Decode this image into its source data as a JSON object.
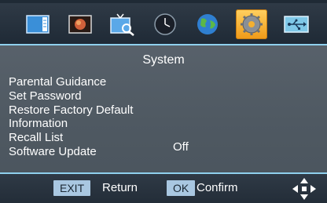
{
  "menu_title": "System",
  "items": [
    {
      "label": "Parental Guidance"
    },
    {
      "label": "Set Password"
    },
    {
      "label": "Restore Factory Default"
    },
    {
      "label": "Information"
    },
    {
      "label": "Recall List"
    },
    {
      "label": "Software Update"
    }
  ],
  "software_update_value": "Off",
  "icons": [
    {
      "name": "channel-list-icon"
    },
    {
      "name": "picture-icon"
    },
    {
      "name": "channel-search-icon"
    },
    {
      "name": "time-icon"
    },
    {
      "name": "language-globe-icon"
    },
    {
      "name": "system-gear-icon",
      "active": true
    },
    {
      "name": "usb-icon"
    }
  ],
  "footer": {
    "exit_key": "EXIT",
    "exit_label": "Return",
    "ok_key": "OK",
    "ok_label": "Confirm"
  },
  "colors": {
    "accent": "#8fd0ee",
    "active_icon": "#f5a623",
    "key_bg": "#a9c7e1"
  }
}
